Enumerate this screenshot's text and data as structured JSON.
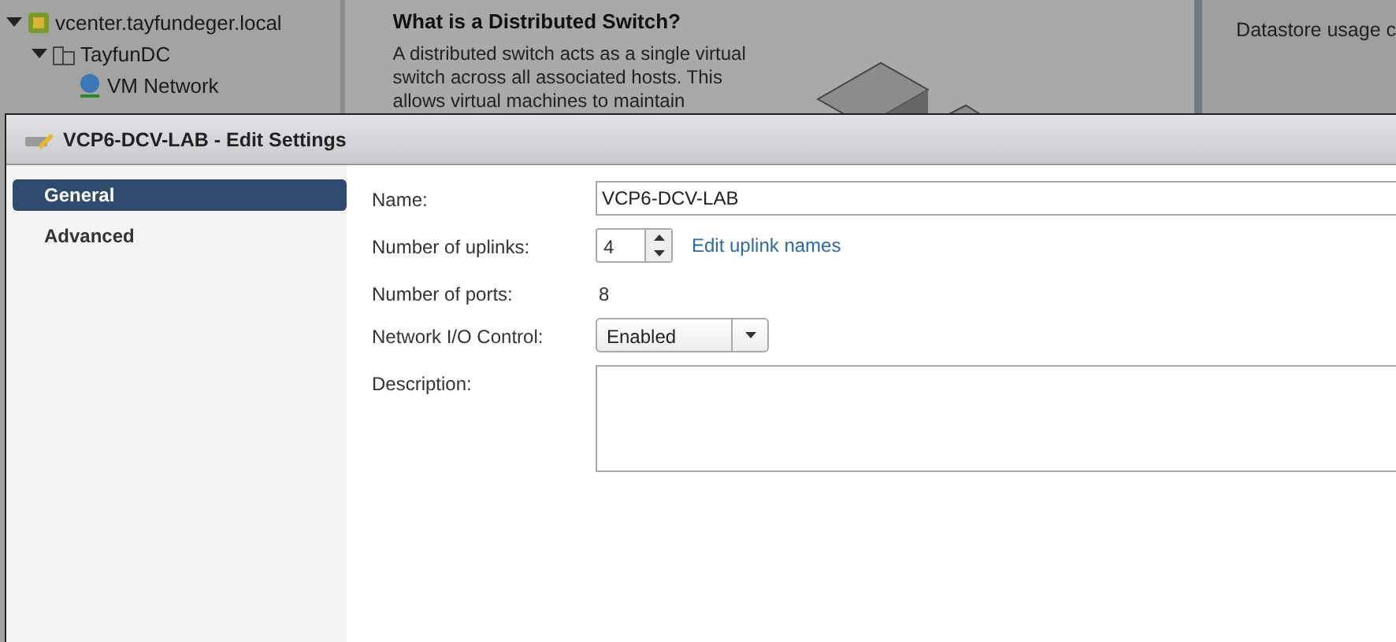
{
  "background": {
    "tree": [
      {
        "label": "vcenter.tayfundeger.local",
        "expanded": true,
        "kind": "vcenter",
        "children": [
          {
            "label": "TayfunDC",
            "expanded": true,
            "kind": "datacenter",
            "children": [
              {
                "label": "VM Network",
                "kind": "network"
              }
            ]
          }
        ]
      }
    ],
    "info": {
      "title": "What is a Distributed Switch?",
      "text": "A distributed switch acts as a single virtual switch across all associated hosts. This allows virtual machines to maintain"
    },
    "side": {
      "label": "Datastore usage c"
    }
  },
  "dialog": {
    "title": "VCP6-DCV-LAB - Edit Settings",
    "nav": [
      {
        "label": "General",
        "selected": true
      },
      {
        "label": "Advanced",
        "selected": false
      }
    ],
    "fields": [
      {
        "kind": "text",
        "label": "Name:",
        "value": "VCP6-DCV-LAB"
      },
      {
        "kind": "spinner",
        "label": "Number of uplinks:",
        "value": "4",
        "link": "Edit uplink names"
      },
      {
        "kind": "static",
        "label": "Number of ports:",
        "value": "8"
      },
      {
        "kind": "select",
        "label": "Network I/O Control:",
        "value": "Enabled"
      },
      {
        "kind": "textarea",
        "label": "Description:"
      }
    ]
  }
}
